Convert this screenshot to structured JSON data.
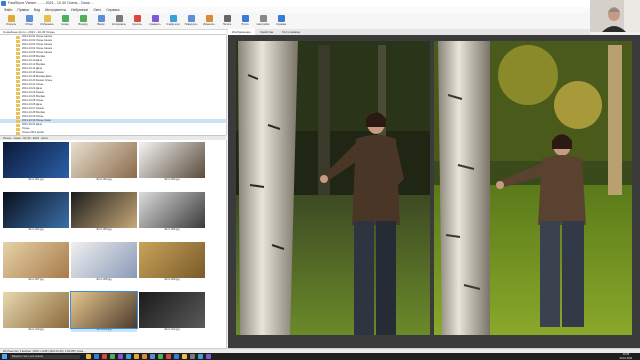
{
  "window": {
    "title": "FastStone Viewer - ... - 2021 - 10-30 Осень - Семя ...",
    "controls": [
      "—",
      "▢",
      "✕"
    ]
  },
  "menu": [
    "Файл",
    "Правка",
    "Вид",
    "Инструменты",
    "Избранное",
    "Окно",
    "Справка"
  ],
  "toolbar": {
    "buttons": [
      {
        "label": "Открыть",
        "color": "#e0a93b"
      },
      {
        "label": "Обзор",
        "color": "#5a8fd6"
      },
      {
        "label": "Избранное",
        "color": "#e6c04a"
      },
      {
        "label": "Назад",
        "color": "#4fae5a"
      },
      {
        "label": "Вперёд",
        "color": "#4fae5a"
      },
      {
        "label": "Вверх",
        "color": "#5a8fd6"
      },
      {
        "label": "Копировать",
        "color": "#7a7a7a"
      },
      {
        "label": "Удалить",
        "color": "#d64a3a"
      },
      {
        "label": "Сравнить",
        "color": "#7a5ad6"
      },
      {
        "label": "Слайд-шоу",
        "color": "#3aa0d6"
      },
      {
        "label": "Повернуть",
        "color": "#5a8fd6"
      },
      {
        "label": "Изменить",
        "color": "#d68a3a"
      },
      {
        "label": "Печать",
        "color": "#666666"
      },
      {
        "label": "Почта",
        "color": "#3a7bd5"
      },
      {
        "label": "Настройки",
        "color": "#888888"
      },
      {
        "label": "Справка",
        "color": "#3a7bd5"
      }
    ]
  },
  "address": "Семейные фото › 2021 › 10-30 Осень",
  "tree": [
    "2021-10-01 Осень Кашин",
    "2021-10-02 Осень Кашин",
    "2021-10-03 Осень Кашин",
    "2021-10-04 Осень Кашин",
    "2021-10-05 Осень Кашин",
    "2021-10-08 Москва",
    "2021-10-10 Дача",
    "2021-10-12 Москва",
    "2021-10-14 Дача",
    "2021-10-16 Кашин",
    "2021-10-18 Москва Дача",
    "2021-10-20 Кашин Осень",
    "2021-10-21 Осень",
    "2021-10-22 Дача",
    "2021-10-23 Кашин",
    "2021-10-24 Москва",
    "2021-10-25 Осень",
    "2021-10-26 Дача",
    "2021-10-27 Кашин",
    "2021-10-28 Москва",
    "2021-10-29 Осень",
    "2021-10-30 Осень Семя",
    "2021-10-31 Дача",
    "Осень",
    "Осень 2021 архив"
  ],
  "tree_selected": 21,
  "path_strip": "Осень - Семя - 10-30 - 2021 - фото",
  "thumbnails": [
    {
      "caption": "Фото 001.jpg",
      "colors": [
        "#0c1a3a",
        "#2a5fa8"
      ]
    },
    {
      "caption": "Фото 002.jpg",
      "colors": [
        "#e8e0d0",
        "#8a6a4a"
      ]
    },
    {
      "caption": "Фото 003.jpg",
      "colors": [
        "#f4f4f4",
        "#5a4a3a"
      ]
    },
    {
      "caption": "Фото 004.jpg",
      "colors": [
        "#0a0f1c",
        "#3a6fa8"
      ]
    },
    {
      "caption": "Фото 005.jpg",
      "colors": [
        "#1c1c1c",
        "#c8a878"
      ]
    },
    {
      "caption": "Фото 006.jpg",
      "colors": [
        "#dcdcdc",
        "#3a3a3a"
      ]
    },
    {
      "caption": "Фото 007.jpg",
      "colors": [
        "#e6d2a8",
        "#a87a4a"
      ]
    },
    {
      "caption": "Фото 008.jpg",
      "colors": [
        "#f0f0f0",
        "#8a9ab8"
      ]
    },
    {
      "caption": "Фото 009.jpg",
      "colors": [
        "#c8a45a",
        "#7a5a2a"
      ]
    },
    {
      "caption": "Фото 010.jpg",
      "colors": [
        "#e8d8b0",
        "#8a6a3a"
      ]
    },
    {
      "caption": "Фото 011.jpg",
      "colors": [
        "#e8c890",
        "#4a3a2a"
      ]
    },
    {
      "caption": "Фото 012.jpg",
      "colors": [
        "#1a1a1a",
        "#5a5a5a"
      ]
    }
  ],
  "thumb_selected": 10,
  "view_tabs": [
    "Изображение",
    "Свойства",
    "Гистограмма"
  ],
  "status": "28 объектов | 1 выбран | 3264 x 2448 | 2021-10-30 | 1.84 MB | Семя ...",
  "taskbar": {
    "search_placeholder": "Введите текст для поиска",
    "app_colors": [
      "#e6b84a",
      "#3a7bd5",
      "#d64a3a",
      "#4fae5a",
      "#7a5ad6",
      "#3aa0d6",
      "#e0a93b",
      "#d68a3a",
      "#5a8fd6",
      "#4fae5a",
      "#d64a3a",
      "#3a7bd5",
      "#e6c04a",
      "#7a7a7a",
      "#3aa0d6",
      "#7a5ad6"
    ],
    "time": "16:20",
    "date": "30.10.2021"
  }
}
